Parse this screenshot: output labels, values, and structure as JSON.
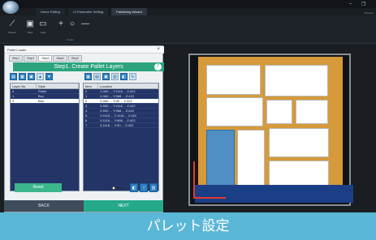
{
  "tabs": [
    "Home Palling",
    "UI Parameter Setting",
    "Palletizing Wizard"
  ],
  "active_tab": 2,
  "window_controls": {
    "minimize": "–",
    "maximize": "❐"
  },
  "properties_label": "Property",
  "ribbon": {
    "buttons": [
      {
        "label": "Wizard",
        "icon": "wand-icon",
        "glyph": "⟋"
      },
      {
        "label": "Save",
        "icon": "save-icon",
        "glyph": "▣"
      },
      {
        "label": "Load",
        "icon": "load-icon",
        "glyph": "▭"
      },
      {
        "label": "",
        "icon": "plus-icon",
        "glyph": "+"
      },
      {
        "label": "",
        "icon": "circle-icon",
        "glyph": "○"
      },
      {
        "label": "",
        "icon": "minus-icon",
        "glyph": "—"
      }
    ],
    "group_label": "Create"
  },
  "dialog": {
    "title": "Pallet Loader",
    "steps": [
      "Step1",
      "Step2",
      "Step3",
      "Step4",
      "Step5"
    ],
    "active_step": 2,
    "banner": "Step1. Create Pallet Layers",
    "help": "?",
    "layer_grid": {
      "columns": [
        "Layer No.",
        "Style"
      ],
      "rows": [
        [
          "0",
          "Pallet"
        ],
        [
          "1",
          "Box"
        ],
        [
          "2",
          "Box"
        ]
      ],
      "selected": 2
    },
    "item_grid": {
      "columns": [
        "Item",
        "Location"
      ],
      "rows": [
        [
          "0",
          "X:340 ... Y:1118 ... Z:422"
        ],
        [
          "1",
          "X:340 ... Y:968 ... Z:422"
        ],
        [
          "2",
          "X:340 ... Y:90 ... Z:422"
        ],
        [
          "3",
          "X:930 ... Y:1118 ... Z:422"
        ],
        [
          "4",
          "X:930 ... Y:968 ... Z:422"
        ],
        [
          "5",
          "X:1118 ... Y:1118 ... Z:422"
        ],
        [
          "6",
          "X:1118 ... Y:568 ... Z:422"
        ],
        [
          "7",
          "X:1118 ... Y:90 ... Z:422"
        ]
      ],
      "selected": 2
    },
    "reset_label": "Reset",
    "snap_label": "snap",
    "back_label": "BACK",
    "next_label": "NEXT"
  },
  "caption": "パレット設定",
  "colors": {
    "pallet": "#d69a3a",
    "selected_box": "#4f8fc4",
    "banner": "#2ba47d",
    "caption": "#5bb7d6"
  }
}
